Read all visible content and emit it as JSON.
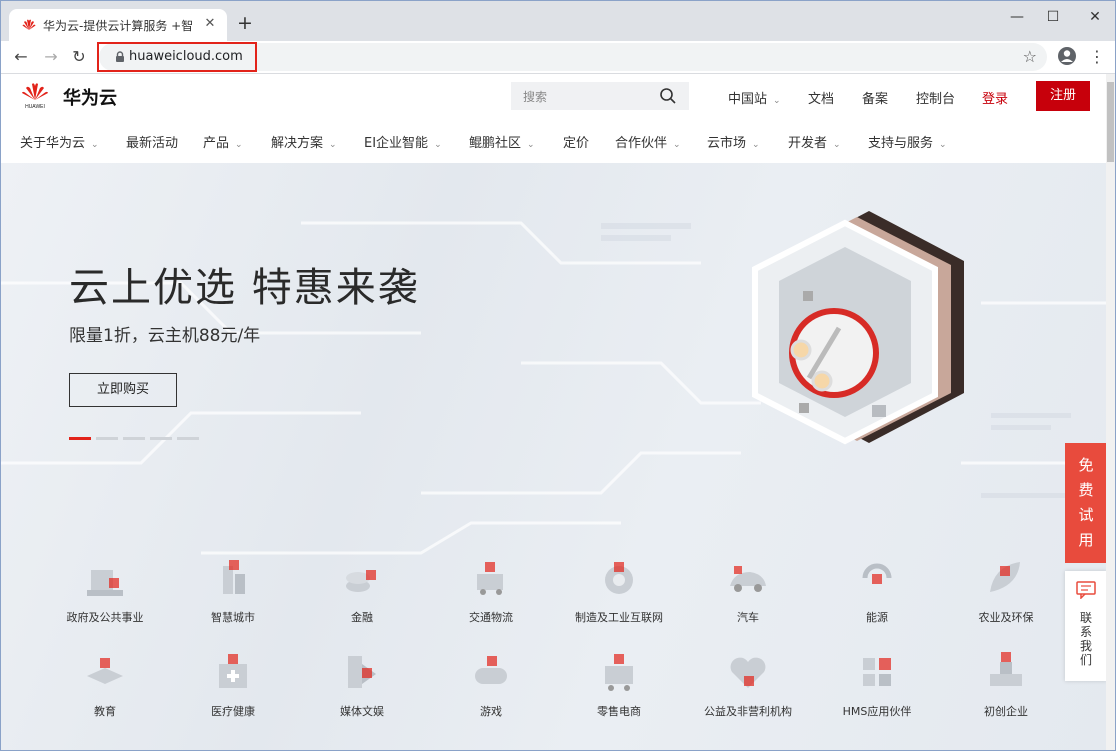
{
  "browser": {
    "tab_title": "华为云-提供云计算服务 +智能、",
    "tab_close": "✕",
    "new_tab": "+",
    "url": "huaweicloud.com",
    "back": "←",
    "forward": "→",
    "reload": "↻",
    "star": "☆",
    "menu": "⋮",
    "minimize": "—",
    "maximize": "☐",
    "close": "✕"
  },
  "header": {
    "brand": "华为云",
    "search_placeholder": "搜索",
    "links": [
      "中国站",
      "文档",
      "备案",
      "控制台",
      "登录"
    ],
    "register": "注册"
  },
  "nav": {
    "items": [
      "关于华为云",
      "最新活动",
      "产品",
      "解决方案",
      "EI企业智能",
      "鲲鹏社区",
      "定价",
      "合作伙伴",
      "云市场",
      "开发者",
      "支持与服务"
    ],
    "caret": "⌄"
  },
  "hero": {
    "title": "云上优选 特惠来袭",
    "subtitle": "限量1折，云主机88元/年",
    "button": "立即购买",
    "active_slide": 1,
    "slide_count": 5
  },
  "industries": {
    "row1": [
      "政府及公共事业",
      "智慧城市",
      "金融",
      "交通物流",
      "制造及工业互联网",
      "汽车",
      "能源",
      "农业及环保"
    ],
    "row2": [
      "教育",
      "医疗健康",
      "媒体文娱",
      "游戏",
      "零售电商",
      "公益及非营利机构",
      "HMS应用伙伴",
      "初创企业"
    ]
  },
  "side": {
    "free_trial": [
      "免",
      "费",
      "试",
      "用"
    ],
    "contact": [
      "联",
      "系",
      "我",
      "们"
    ]
  },
  "colors": {
    "brand_red": "#c7000b",
    "trial_red": "#e84b3d",
    "highlight_box": "#e2231a"
  }
}
